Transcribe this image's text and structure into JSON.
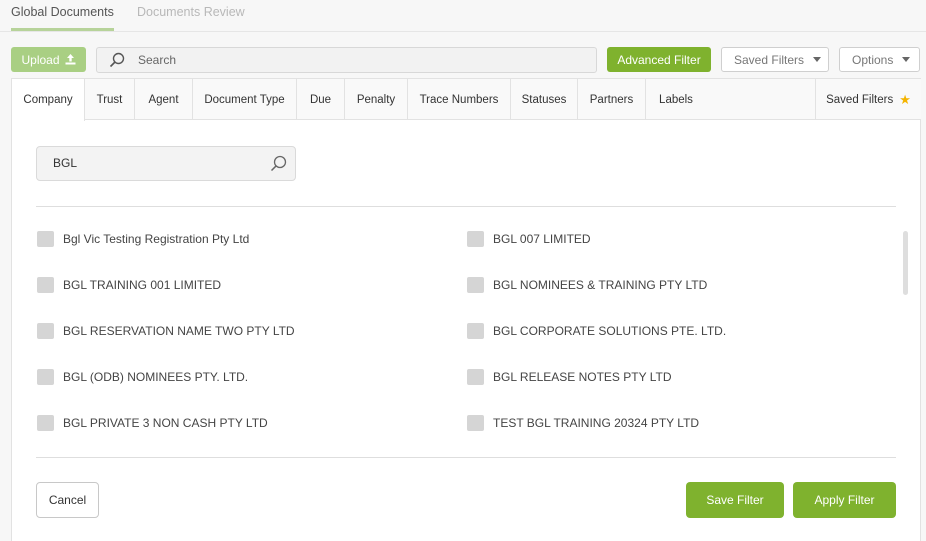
{
  "top_tabs": {
    "global_documents": "Global Documents",
    "documents_review": "Documents Review"
  },
  "toolbar": {
    "upload_label": "Upload",
    "search_placeholder": "Search",
    "advanced_filter_label": "Advanced Filter",
    "saved_filters_label": "Saved Filters",
    "options_label": "Options"
  },
  "filter_tabs": [
    "Company",
    "Trust",
    "Agent",
    "Document Type",
    "Due",
    "Penalty",
    "Trace Numbers",
    "Statuses",
    "Partners",
    "Labels"
  ],
  "saved_filters_tab": "Saved Filters",
  "company_search": {
    "value": "BGL"
  },
  "companies_left": [
    "Bgl Vic Testing Registration Pty Ltd",
    "BGL TRAINING 001 LIMITED",
    "BGL RESERVATION NAME TWO PTY LTD",
    "BGL (ODB) NOMINEES PTY. LTD.",
    "BGL PRIVATE 3 NON CASH PTY LTD"
  ],
  "companies_right": [
    "BGL 007 LIMITED",
    "BGL NOMINEES & TRAINING PTY LTD",
    "BGL CORPORATE SOLUTIONS PTE. LTD.",
    "BGL RELEASE NOTES PTY LTD",
    "TEST BGL TRAINING 20324 PTY LTD"
  ],
  "actions": {
    "cancel": "Cancel",
    "save_filter": "Save Filter",
    "apply_filter": "Apply Filter"
  },
  "colors": {
    "primary_green": "#7fb22e",
    "upload_green": "#a9cf83",
    "star": "#f4b400"
  }
}
